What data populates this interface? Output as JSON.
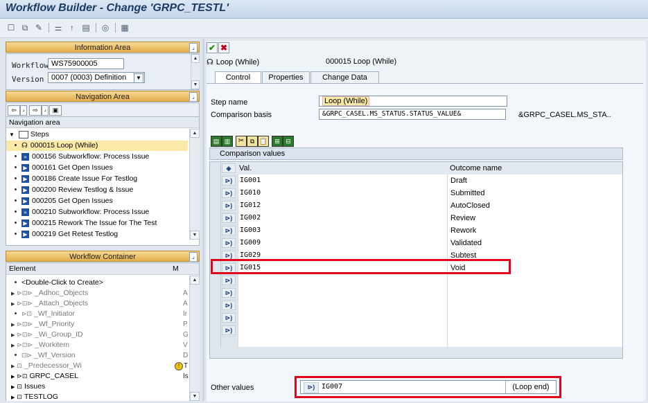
{
  "window": {
    "title": "Workflow Builder - Change 'GRPC_TESTL'"
  },
  "info_area": {
    "header": "Information Area",
    "workflow_label": "Workflow",
    "workflow_value": "WS75900005",
    "version_label": "Version",
    "version_value": "0007 (0003) Definition"
  },
  "nav_area": {
    "header": "Navigation Area",
    "subheader": "Navigation area",
    "root": "Steps",
    "items": [
      {
        "label": "000015 Loop (While)",
        "icon": "loop-icon",
        "selected": true
      },
      {
        "label": "000156 Subworkflow: Process Issue",
        "icon": "subworkflow-icon"
      },
      {
        "label": "000161 Get Open Issues",
        "icon": "activity-icon"
      },
      {
        "label": "000186 Create Issue For Testlog",
        "icon": "activity-icon"
      },
      {
        "label": "000200 Review Testlog & Issue",
        "icon": "activity-icon"
      },
      {
        "label": "000205 Get Open Issues",
        "icon": "activity-icon"
      },
      {
        "label": "000210 Subworkflow: Process Issue",
        "icon": "subworkflow-icon"
      },
      {
        "label": "000215 Rework The Issue for The Test",
        "icon": "activity-icon"
      },
      {
        "label": "000219 Get Retest Testlog",
        "icon": "activity-icon"
      }
    ]
  },
  "container": {
    "header": "Workflow Container",
    "col_element": "Element",
    "col_m": "M",
    "items": [
      {
        "label": "<Double-Click to Create>",
        "right": ""
      },
      {
        "label": "_Adhoc_Objects",
        "right": "A"
      },
      {
        "label": "_Attach_Objects",
        "right": "A"
      },
      {
        "label": "_Wf_Initiator",
        "right": "Ir"
      },
      {
        "label": "_Wf_Priority",
        "right": "P"
      },
      {
        "label": "_Wi_Group_ID",
        "right": "G"
      },
      {
        "label": "_Workitem",
        "right": "V"
      },
      {
        "label": "_Wf_Version",
        "right": "D"
      },
      {
        "label": "_Predecessor_Wi",
        "right": ""
      },
      {
        "label": "GRPC_CASEL",
        "right": "T"
      },
      {
        "label": "Issues",
        "right": "Is"
      },
      {
        "label": "TESTLOG",
        "right": ""
      }
    ]
  },
  "step": {
    "title_left": "Loop (While)",
    "title_right": "000015  Loop (While)",
    "tabs": [
      "Control",
      "Properties",
      "Change Data"
    ],
    "step_name_label": "Step name",
    "step_name_value": "Loop (While)",
    "comparison_label": "Comparison basis",
    "comparison_value": "&GRPC_CASEL.MS_STATUS.STATUS_VALUE&",
    "comparison_display": "&GRPC_CASEL.MS_STA.."
  },
  "comparison": {
    "header": "Comparison values",
    "col_val": "Val.",
    "col_outcome": "Outcome name",
    "rows": [
      {
        "val": "IG001",
        "outcome": "Draft"
      },
      {
        "val": "IG010",
        "outcome": "Submitted"
      },
      {
        "val": "IG012",
        "outcome": "AutoClosed"
      },
      {
        "val": "IG002",
        "outcome": "Review"
      },
      {
        "val": "IG003",
        "outcome": "Rework"
      },
      {
        "val": "IG009",
        "outcome": "Validated"
      },
      {
        "val": "IG029",
        "outcome": "Subtest"
      },
      {
        "val": "IG015",
        "outcome": "Void"
      }
    ],
    "other_label": "Other values",
    "other_value": "IG007",
    "other_outcome": "(Loop end)"
  },
  "colors": {
    "highlight": "#e3001b",
    "selected_row": "#fbe9a8",
    "header": "#e9b955"
  }
}
